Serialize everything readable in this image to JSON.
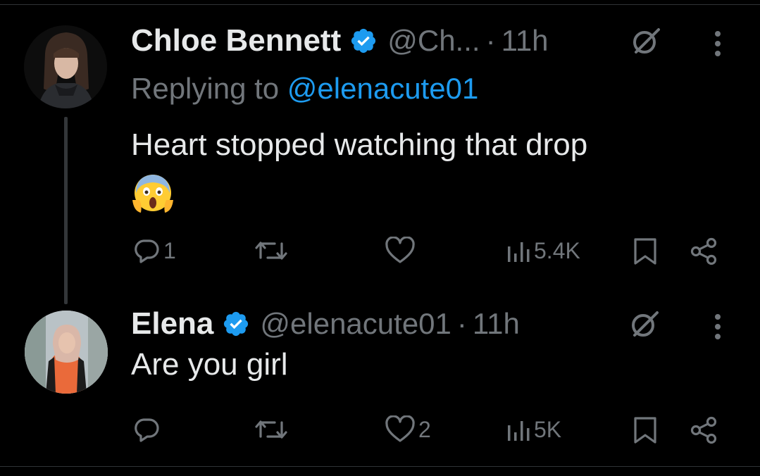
{
  "tweets": [
    {
      "display_name": "Chloe Bennett",
      "handle": "@Ch...",
      "separator": "·",
      "time": "11h",
      "replying_prefix": "Replying to ",
      "replying_to": "@elenacute01",
      "text": "Heart stopped watching that drop",
      "emoji": "😱",
      "actions": {
        "reply_count": "1",
        "retweet_count": "",
        "like_count": "",
        "views_count": "5.4K"
      }
    },
    {
      "display_name": "Elena",
      "handle": "@elenacute01",
      "separator": "·",
      "time": "11h",
      "text": "Are you girl",
      "actions": {
        "reply_count": "",
        "retweet_count": "",
        "like_count": "2",
        "views_count": "5K"
      }
    }
  ],
  "colors": {
    "background": "#000000",
    "text_primary": "#e7e9ea",
    "text_secondary": "#71767b",
    "accent": "#1d9bf0",
    "divider": "#2f3336"
  },
  "icons": [
    "verified-badge-icon",
    "grok-icon",
    "more-options-icon",
    "reply-icon",
    "retweet-icon",
    "like-icon",
    "views-icon",
    "bookmark-icon",
    "share-icon"
  ]
}
